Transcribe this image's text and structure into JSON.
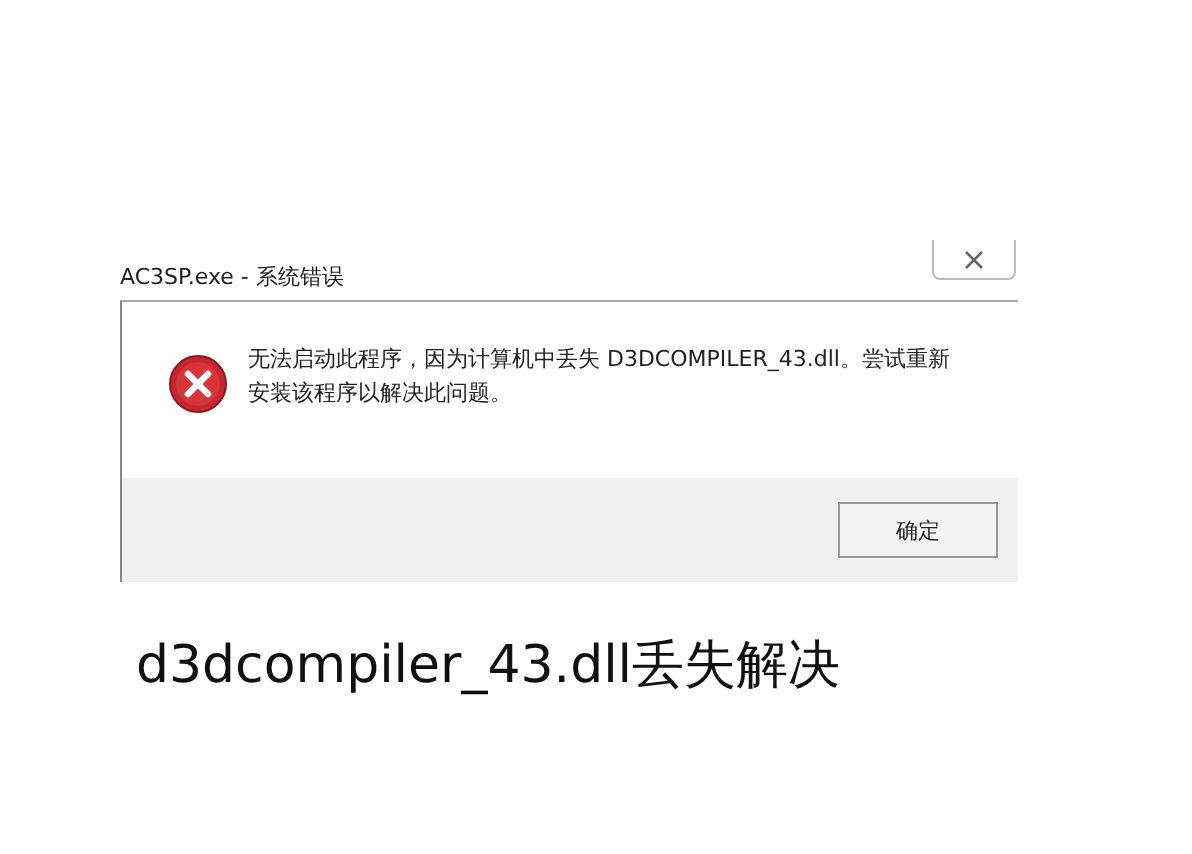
{
  "window": {
    "title": "AC3SP.exe - 系统错误"
  },
  "dialog": {
    "message": "无法启动此程序，因为计算机中丢失 D3DCOMPILER_43.dll。尝试重新安装该程序以解决此问题。",
    "buttons": [
      {
        "label": "确定"
      }
    ]
  },
  "caption": "d3dcompiler_43.dll丢失解决"
}
